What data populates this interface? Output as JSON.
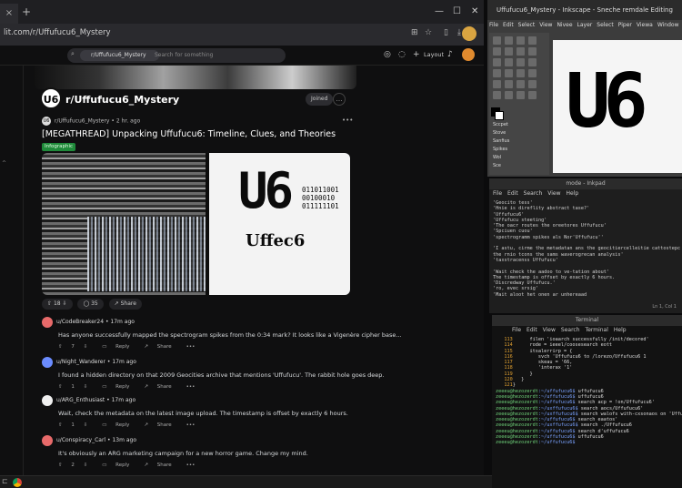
{
  "chrome": {
    "tab_label": "",
    "url": "lit.com/r/Uffufucu6_Mystery",
    "header": {
      "search_pill": "r/Uffufucu6_Mystery",
      "search_placeholder": "Search for something",
      "layout_label": "Layout"
    },
    "subreddit": {
      "name": "r/Uffufucu6_Mystery",
      "avatar_text": "U6",
      "join_label": "Joined"
    },
    "post": {
      "subreddit": "r/Uffufucu6_Mystery",
      "time": "2 hr. ago",
      "title": "[MEGATHREAD] Unpacking Uffufucu6: Timeline, Clues, and Theories",
      "flair": "Infographic",
      "image_logo": "U6",
      "image_binary": "011011001\n00100010\n011111101",
      "image_subtitle": "Uffec6",
      "votes": "18",
      "comments": "35",
      "share_label": "Share"
    },
    "comments": [
      {
        "user": "u/CodeBreaker24",
        "time": "17m ago",
        "color": "#e86a6a",
        "text": "Has anyone successfully mapped the spectrogram spikes from the 0:34 mark? It looks like a Vigenère cipher base...",
        "votes": "7",
        "reply": "Reply",
        "share": "Share"
      },
      {
        "user": "u/Night_Wanderer",
        "time": "17m ago",
        "color": "#6b8cff",
        "text": "I found a hidden directory on that 2009 Geocities archive that mentions 'Uffufucu'. The rabbit hole goes deep.",
        "votes": "1",
        "reply": "Reply",
        "share": "Share"
      },
      {
        "user": "u/ARG_Enthusiast",
        "time": "17m ago",
        "color": "#f0f0f0",
        "text": "Wait, check the metadata on the latest image upload. The timestamp is offset by exactly 6 hours.",
        "votes": "1",
        "reply": "Reply",
        "share": "Share"
      },
      {
        "user": "u/Conspiracy_Carl",
        "time": "13m ago",
        "color": "#e86a6a",
        "text": "It's obviously an ARG marketing campaign for a new horror game. Change my mind.",
        "votes": "2",
        "reply": "Reply",
        "share": "Share"
      }
    ]
  },
  "inkscape": {
    "title": "Uffufucu6_Mystery - Inkscape - Sneche remdale Editing",
    "menu": [
      "File",
      "Edit",
      "Select",
      "View",
      "Nivee",
      "Layer",
      "Select",
      "Piper",
      "Viewa",
      "Window",
      "Help"
    ],
    "canvas_text": "U6"
  },
  "inkpad": {
    "title": "mode - Inkpad",
    "menu": [
      "File",
      "Edit",
      "Search",
      "View",
      "Help"
    ],
    "lines": [
      "'Geocito tess'",
      "'Hnie is direflity abstract tase?'",
      "'Uffufucu6'",
      "'Uffufucu steeting'",
      "'The oacr routes the oreetores Uffufucu'",
      "'Spciuen cuou'",
      "'spectrogramm spikes als Nor'Uffufucu''",
      "",
      "'I astu, cirme the metadatan ans the geocitiercelleitie cattostepc",
      "the rnio tcons the sams waverogrecan analysis'",
      "'taxstracenss Uffufucu'",
      "",
      "'Wait check the aadoo to ve-tation about'",
      "The timestamp is offset by exactly 6 hours.",
      "'Discredway Uffufucu.'",
      "'ro, evec srsig'",
      "'Mait aloot het onen ar unhereaad"
    ],
    "status": "Ln 1, Col 1"
  },
  "terminal": {
    "title": "Terminal",
    "menu": [
      "File",
      "Edit",
      "View",
      "Search",
      "Terminal",
      "Help"
    ],
    "lines": [
      {
        "n": "113",
        "t": "      filen 'ioaarch successfully /init/decored'"
      },
      {
        "n": "114",
        "t": "      rode = ieeel/coosesearch eott"
      },
      {
        "n": "115",
        "t": "      itsalerrirp = {"
      },
      {
        "n": "116",
        "t": "         svch 'Uffufucu6 to /lorezo/Uffufucu6 1"
      },
      {
        "n": "117",
        "t": "         skeau = '66,"
      },
      {
        "n": "118",
        "t": "         'interax '1'"
      },
      {
        "n": "119",
        "t": "      }"
      },
      {
        "n": "120",
        "t": "   }"
      },
      {
        "n": "121",
        "t": "}"
      }
    ],
    "prompts": [
      {
        "user": "zeeeu@hezozerdt",
        "path": ":~/uffufucu6$",
        "cmd": " uffufucu6"
      },
      {
        "user": "zeeeu@hezozerdt",
        "path": ":~/uffufucu6$",
        "cmd": " uffufucu6"
      },
      {
        "user": "zeeeu@hezozerdt",
        "path": ":~/uffufucu6$",
        "cmd": " search acp = !on/Uffufucu6'"
      },
      {
        "user": "zeeeu@hezozerdt",
        "path": ":~/uxffufucu6$",
        "cmd": " search aocs/Uffufucu6'"
      },
      {
        "user": "zeeeu@hezozerdt",
        "path": ":~/uxffufucu6$",
        "cmd": " search walofs with-cxsonaos on 'Uffufucu6"
      },
      {
        "user": "zeeeu@hezozerdt",
        "path": ":~/uffufucu6$",
        "cmd": " search eaatos'"
      },
      {
        "user": "zeeeu@hezozerdt",
        "path": ":~/uxffufucu6$",
        "cmd": " search ./Uffufucu6"
      },
      {
        "user": "zeeeu@hezozerdt",
        "path": ":~/uffufucu6$",
        "cmd": " search d'uffufucu6"
      },
      {
        "user": "zeeeu@hezozerdt",
        "path": ":~/uffufucu6$",
        "cmd": " uffufucu6"
      },
      {
        "user": "zeeeu@hezozerdt",
        "path": ":~/uffufucu6$",
        "cmd": ""
      }
    ]
  }
}
